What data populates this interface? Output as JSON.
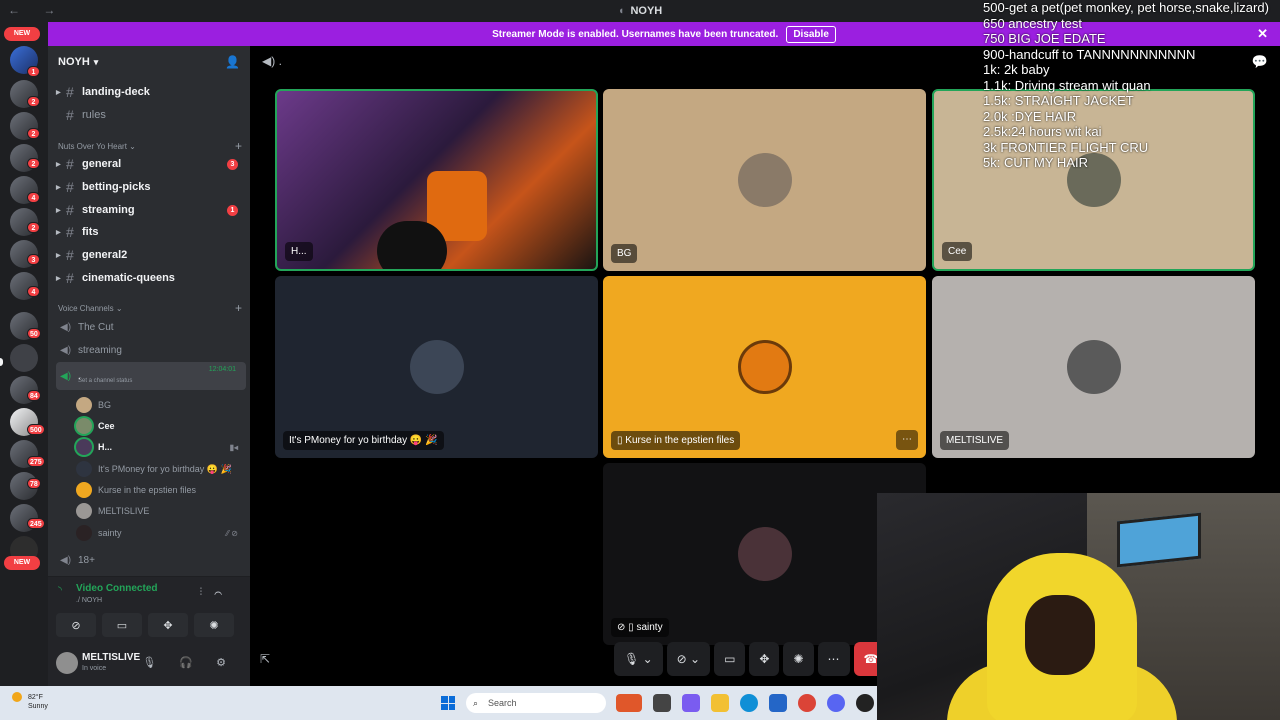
{
  "window": {
    "title": "NOYH",
    "nav": "← →"
  },
  "banner": {
    "text": "Streamer Mode is enabled. Usernames have been truncated.",
    "disable_label": "Disable"
  },
  "rail": {
    "new_label_top": "NEW",
    "new_label_bottom": "NEW",
    "badges": [
      "1",
      "2",
      "2",
      "2",
      "4",
      "2",
      "3",
      "4",
      "2",
      "50",
      "84",
      "500",
      "275",
      "78",
      "245"
    ]
  },
  "guild": {
    "name": "NOYH"
  },
  "channels": {
    "top": [
      {
        "name": "landing-deck",
        "unread": ""
      },
      {
        "name": "rules",
        "unread": ""
      }
    ],
    "category1": "Nuts Over Yo Heart",
    "list": [
      {
        "name": "general",
        "unread": "3"
      },
      {
        "name": "betting-picks",
        "unread": ""
      },
      {
        "name": "streaming",
        "unread": "1"
      },
      {
        "name": "fits",
        "unread": ""
      },
      {
        "name": "general2",
        "unread": ""
      },
      {
        "name": "cinematic-queens",
        "unread": ""
      }
    ],
    "voice_category": "Voice Channels",
    "voice": [
      "The Cut",
      "streaming"
    ],
    "active_voice": {
      "name": ".",
      "timer": "12:04:01",
      "status": "Set a channel status"
    },
    "members": [
      "BG",
      "Cee",
      "H...",
      "It's PMoney for yo birthday 😛 🎉",
      "Kurse in the epstien files",
      "MELTISLIVE",
      "sainty"
    ],
    "extra": "18+"
  },
  "voicebar": {
    "status": "Video Connected",
    "sub": "./ NOYH"
  },
  "user": {
    "name": "MELTISLIVE",
    "status": "In voice"
  },
  "stage": {
    "header": ".",
    "tiles": [
      {
        "name": "H...",
        "color": "#3b2a4a"
      },
      {
        "name": "BG",
        "color": "#c4a882"
      },
      {
        "name": "Cee",
        "color": "#c8b595"
      },
      {
        "name": "It's PMoney for yo birthday 😛 🎉",
        "color": "#1f2530"
      },
      {
        "name": "Kurse in the epstien files",
        "color": "#f0a820"
      },
      {
        "name": "MELTISLIVE",
        "color": "#b5b1ae"
      },
      {
        "name": "sainty",
        "color": "#121214"
      }
    ]
  },
  "goals": [
    "500-get a pet(pet monkey, pet horse,snake,lizard)",
    "650 ancestry test",
    "750 BIG JOE EDATE",
    "900-handcuff to TANNNNNNNNNNN",
    "1k: 2k baby",
    "1.1k: Driving stream wit quan",
    "1.5k: STRAIGHT JACKET",
    "2.0k :DYE HAIR",
    "2.5k:24 hours wit kai",
    "3k FRONTIER FLIGHT CRU",
    "5k: CUT MY HAIR"
  ],
  "taskbar": {
    "temp": "82°F",
    "condition": "Sunny",
    "search": "Search"
  }
}
